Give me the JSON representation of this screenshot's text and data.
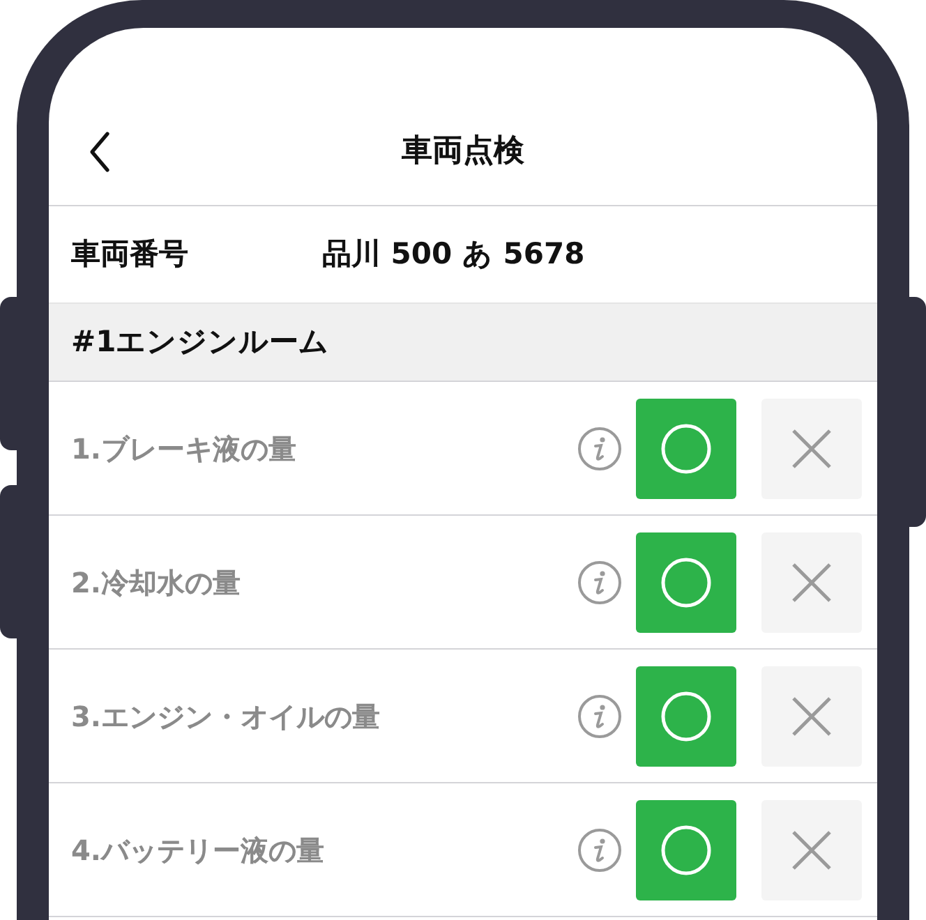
{
  "header": {
    "title": "車両点検"
  },
  "vehicle": {
    "label": "車両番号",
    "value": "品川 500 あ 5678"
  },
  "section": {
    "title": "#1エンジンルーム"
  },
  "items": [
    {
      "label": "1.ブレーキ液の量",
      "ok": {
        "selected": true
      },
      "ng": {
        "selected": false
      }
    },
    {
      "label": "2.冷却水の量",
      "ok": {
        "selected": true
      },
      "ng": {
        "selected": false
      }
    },
    {
      "label": "3.エンジン・オイルの量",
      "ok": {
        "selected": true
      },
      "ng": {
        "selected": false
      }
    },
    {
      "label": "4.バッテリー液の量",
      "ok": {
        "selected": true
      },
      "ng": {
        "selected": false
      }
    }
  ]
}
